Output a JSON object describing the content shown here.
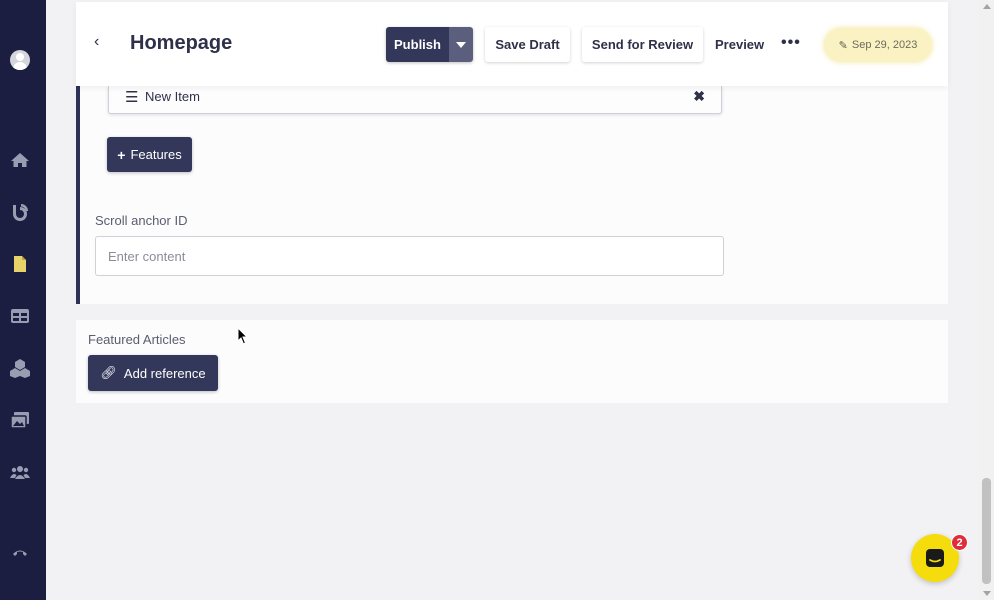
{
  "header": {
    "title": "Homepage",
    "publish_label": "Publish",
    "save_draft_label": "Save Draft",
    "send_review_label": "Send for Review",
    "preview_label": "Preview",
    "more_label": "•••",
    "date": "Sep 29, 2023"
  },
  "list": {
    "item_label": "New Item"
  },
  "features_button": {
    "label": "Features"
  },
  "scroll_anchor": {
    "label": "Scroll anchor ID",
    "placeholder": "Enter content",
    "value": ""
  },
  "featured_articles": {
    "label": "Featured Articles",
    "add_reference_label": "Add reference"
  },
  "chat": {
    "badge_count": "2"
  },
  "colors": {
    "sidebar_bg": "#1b1e40",
    "primary_button": "#33375a",
    "accent_yellow": "#f5dc0c",
    "active_nav_icon": "#e8d36a",
    "badge_red": "#e02d3c"
  },
  "sidebar_icons": [
    "avatar",
    "home-icon",
    "blog-icon",
    "page-icon",
    "table-icon",
    "cubes-icon",
    "media-icon",
    "users-icon",
    "phone-icon"
  ]
}
